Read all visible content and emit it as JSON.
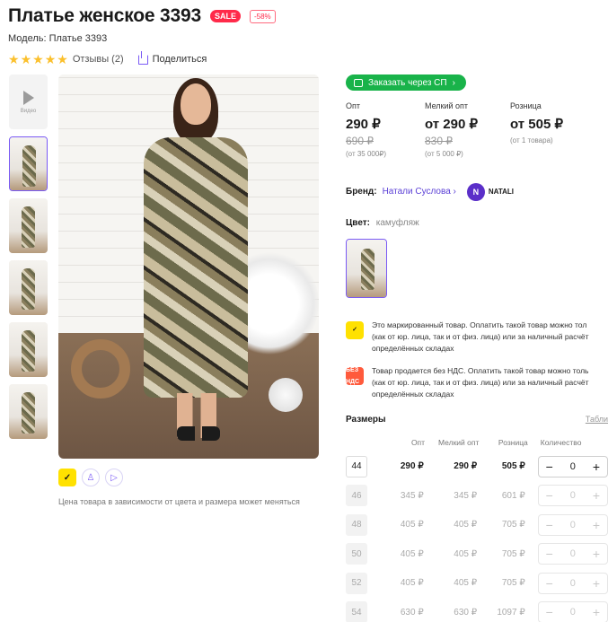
{
  "product": {
    "title": "Платье женское 3393",
    "sale_badge": "SALE",
    "discount_badge": "-58%",
    "model": "Модель: Платье 3393",
    "reviews": "Отзывы (2)",
    "share": "Поделиться",
    "rating_stars": 5
  },
  "gallery": {
    "video_label": "Видео",
    "thumbnails_count": 5,
    "price_note": "Цена товара в зависимости от цвета и размера может меняться"
  },
  "order": {
    "label": "Заказать через СП"
  },
  "prices": [
    {
      "label": "Опт",
      "value": "290 ₽",
      "old": "690 ₽",
      "note": "(от 35 000₽)"
    },
    {
      "label": "Мелкий опт",
      "value": "от 290 ₽",
      "old": "830 ₽",
      "note": "(от 5 000 ₽)"
    },
    {
      "label": "Розница",
      "value": "от 505 ₽",
      "old": "",
      "note": "(от 1 товара)"
    }
  ],
  "brand": {
    "label": "Бренд:",
    "name": "Натали Суслова",
    "logo_text": "NATALI"
  },
  "color": {
    "label": "Цвет:",
    "value": "камуфляж"
  },
  "notices": [
    {
      "icon_text": "",
      "line1": "Это маркированный товар. Оплатить такой товар можно тол",
      "line2": "(как от юр. лица, так и от физ. лица) или за наличный расчёт",
      "line3": "определённых складах"
    },
    {
      "icon_text": "БЕЗ НДС",
      "line1": "Товар продается без НДС. Оплатить такой товар можно толь",
      "line2": "(как от юр. лица, так и от физ. лица) или за наличный расчёт",
      "line3": "определённых складах"
    }
  ],
  "sizes": {
    "title": "Размеры",
    "table_link": "Табли",
    "headers": {
      "opt": "Опт",
      "mopt": "Мелкий опт",
      "retail": "Розница",
      "qty": "Количество"
    },
    "rows": [
      {
        "size": "44",
        "opt": "290 ₽",
        "mopt": "290 ₽",
        "retail": "505 ₽",
        "qty": "0"
      },
      {
        "size": "46",
        "opt": "345 ₽",
        "mopt": "345 ₽",
        "retail": "601 ₽",
        "qty": "0"
      },
      {
        "size": "48",
        "opt": "405 ₽",
        "mopt": "405 ₽",
        "retail": "705 ₽",
        "qty": "0"
      },
      {
        "size": "50",
        "opt": "405 ₽",
        "mopt": "405 ₽",
        "retail": "705 ₽",
        "qty": "0"
      },
      {
        "size": "52",
        "opt": "405 ₽",
        "mopt": "405 ₽",
        "retail": "705 ₽",
        "qty": "0"
      },
      {
        "size": "54",
        "opt": "630 ₽",
        "mopt": "630 ₽",
        "retail": "1097 ₽",
        "qty": "0"
      }
    ]
  },
  "colors": {
    "accent": "#7a5af5",
    "sale": "#ff2a4a",
    "order_green": "#19b34a",
    "honest_yellow": "#ffe100"
  }
}
